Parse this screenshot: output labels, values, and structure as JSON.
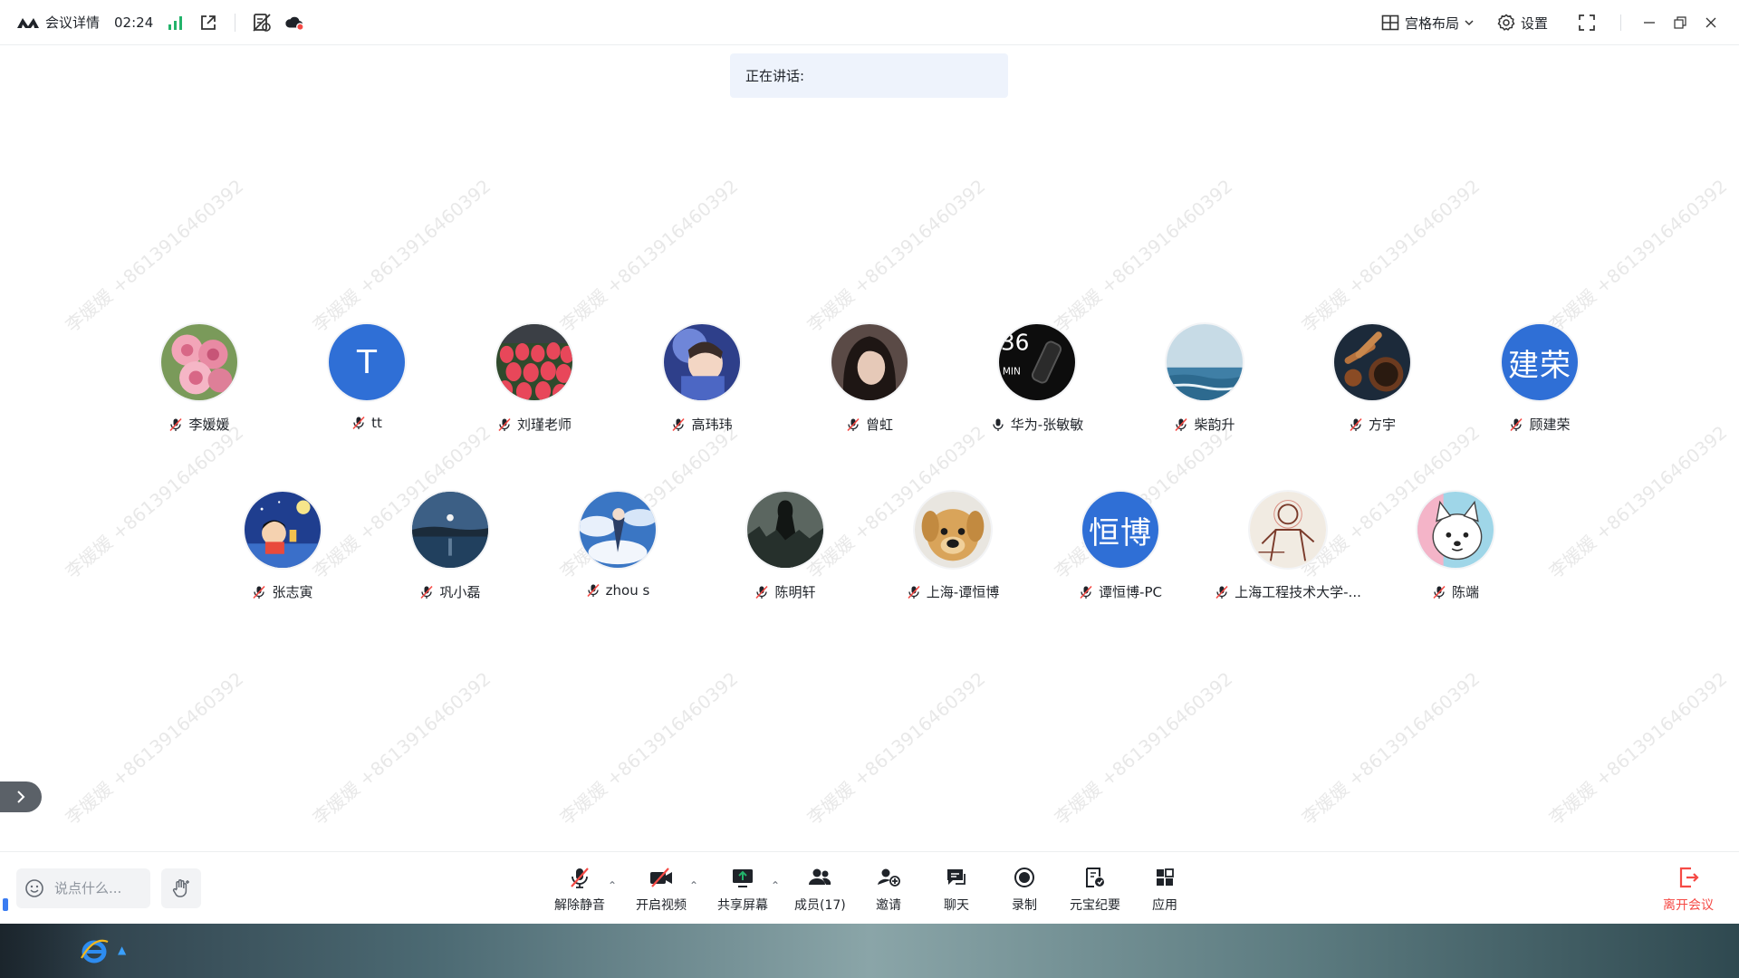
{
  "titlebar": {
    "meeting_details": "会议详情",
    "elapsed": "02:24",
    "layout": "宫格布局",
    "settings": "设置"
  },
  "speaking_label": "正在讲话:",
  "watermark": "李媛媛 +8613916460392",
  "participants_row1": [
    {
      "name": "李媛媛",
      "avatar": "photo-roses",
      "mic": "muted"
    },
    {
      "name": "tt",
      "avatar": "text",
      "initial": "T",
      "mic": "muted"
    },
    {
      "name": "刘瑾老师",
      "avatar": "photo-tulips",
      "mic": "muted"
    },
    {
      "name": "高玮玮",
      "avatar": "photo-child",
      "mic": "muted"
    },
    {
      "name": "曾虹",
      "avatar": "photo-girl",
      "mic": "muted"
    },
    {
      "name": "华为-张敏敏",
      "avatar": "photo-watch",
      "mic": "on"
    },
    {
      "name": "柴韵升",
      "avatar": "photo-sea",
      "mic": "muted"
    },
    {
      "name": "方宇",
      "avatar": "photo-tea",
      "mic": "muted"
    },
    {
      "name": "顾建荣",
      "avatar": "text",
      "initial": "建荣",
      "mic": "muted"
    }
  ],
  "participants_row2": [
    {
      "name": "张志寅",
      "avatar": "photo-cartoon-night",
      "mic": "muted"
    },
    {
      "name": "巩小磊",
      "avatar": "photo-moon-lake",
      "mic": "muted"
    },
    {
      "name": "zhou s",
      "avatar": "photo-anime-sky",
      "mic": "muted"
    },
    {
      "name": "陈明轩",
      "avatar": "photo-dark-figure",
      "mic": "muted"
    },
    {
      "name": "上海-谭恒博",
      "avatar": "photo-dog",
      "mic": "muted"
    },
    {
      "name": "谭恒博-PC",
      "avatar": "text",
      "initial": "恒博",
      "mic": "muted"
    },
    {
      "name": "上海工程技术大学-...",
      "avatar": "photo-sketch",
      "mic": "muted"
    },
    {
      "name": "陈端",
      "avatar": "photo-white-dog",
      "mic": "muted"
    }
  ],
  "toolbar": {
    "chat_placeholder": "说点什么...",
    "unmute": "解除静音",
    "start_video": "开启视频",
    "share_screen": "共享屏幕",
    "members": "成员(17)",
    "invite": "邀请",
    "chat": "聊天",
    "record": "录制",
    "minutes": "元宝纪要",
    "apps": "应用",
    "leave": "离开会议"
  },
  "colors": {
    "accent": "#2f6fd6",
    "leave": "#f54a45",
    "signal": "#23b36b",
    "banner": "#eef3fc"
  }
}
